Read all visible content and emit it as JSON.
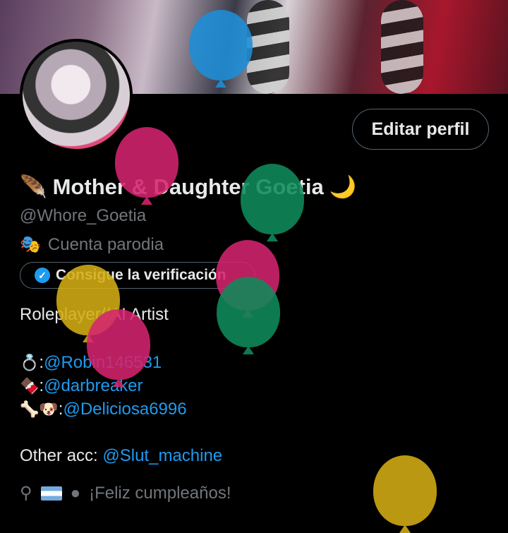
{
  "profile": {
    "edit_label": "Editar perfil",
    "name_lead_icon": "feather-icon",
    "name": "Mother & Daughter Goetia",
    "name_trail_icon": "crescent-moon-icon",
    "handle": "@Whore_Goetia",
    "parody_label": "Cuenta parodia",
    "verify_label": "Consigue la verificación",
    "bio": "Roleplayer//AI Artist",
    "relations": [
      {
        "emoji": "💍",
        "sep": ":",
        "handle": "@Robin146531"
      },
      {
        "emoji": "🍫",
        "sep": ":",
        "handle": "@darbreaker"
      },
      {
        "emoji": "🦴🐶",
        "sep": ":",
        "handle": "@Deliciosa6996"
      }
    ],
    "other_prefix": "Other acc: ",
    "other_handle": "@Slut_machine",
    "birthday": "¡Feliz cumpleaños!"
  },
  "colors": {
    "link": "#1d9bf0",
    "muted": "#71767b",
    "text": "#e7e9ea",
    "background": "#000000"
  }
}
